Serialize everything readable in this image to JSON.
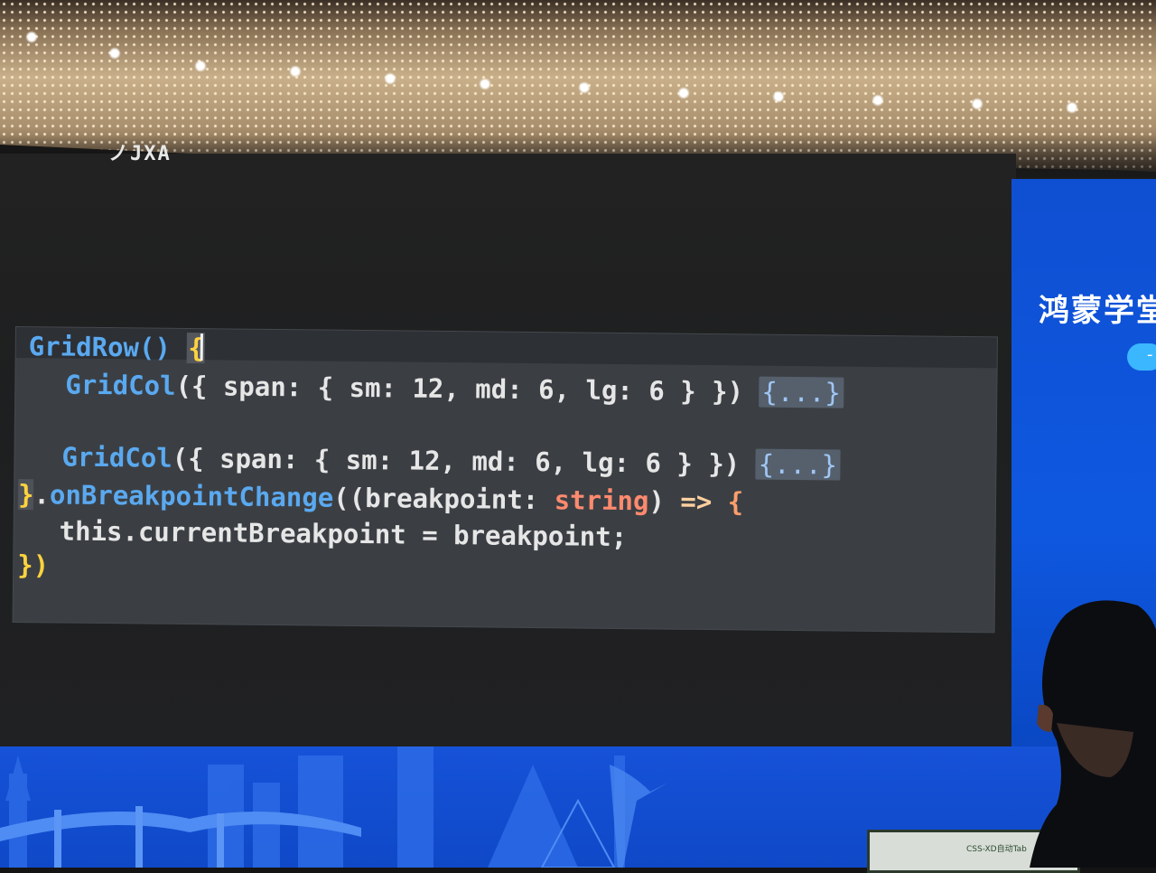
{
  "slide": {
    "corner_glyph": "ノJXA",
    "side_title": "鸿蒙学堂",
    "side_pill": "-",
    "monitor_label": "CSS-XD自动Tab"
  },
  "code": {
    "line1": {
      "fn": "GridRow",
      "paren": "()",
      "brace": "{"
    },
    "line2": {
      "fn": "GridCol",
      "text": "({ span: { sm: 12, md: 6, lg: 6 } })",
      "fold": "{...}"
    },
    "line3": {
      "fn": "GridCol",
      "text": "({ span: { sm: 12, md: 6, lg: 6 } })",
      "fold": "{...}"
    },
    "line4": {
      "close": "}",
      "dot": ".",
      "method": "onBreakpointChange",
      "args_open": "((breakpoint: ",
      "type": "string",
      "args_close": ")",
      "arrow": " => ",
      "brace": "{"
    },
    "line5": {
      "text": "this.currentBreakpoint = breakpoint;"
    },
    "line6": {
      "text": "})"
    }
  },
  "colors": {
    "code_background": "#3b3f44",
    "function": "#5aa9f0",
    "brace": "#ffd23e",
    "number": "#9ee68b",
    "type": "#ff8a6e",
    "panel_blue": "#0f4fd2"
  }
}
